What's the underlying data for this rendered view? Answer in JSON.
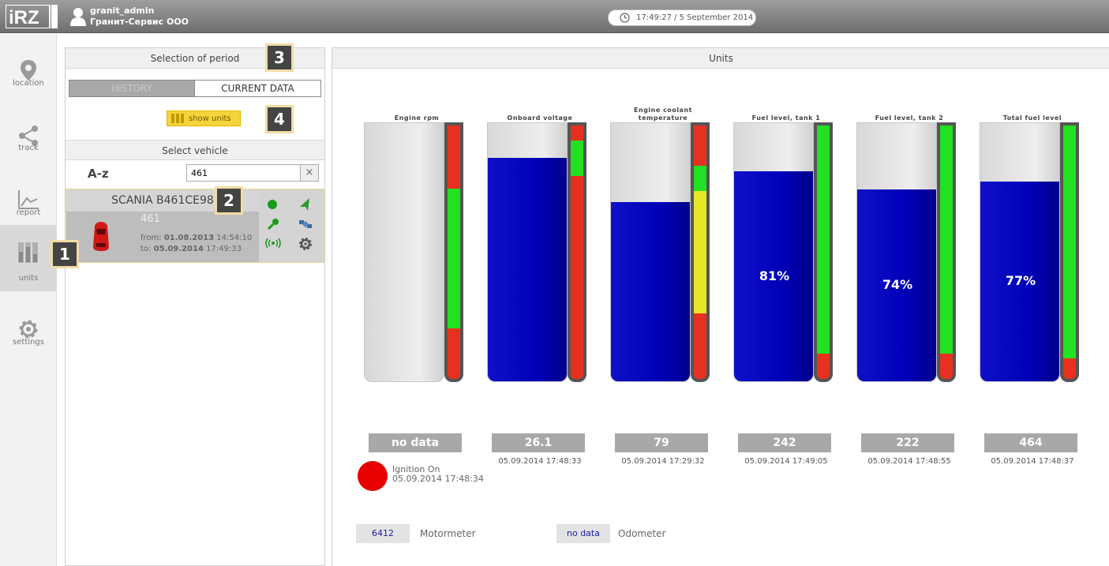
{
  "header": {
    "logo_text": "iRZ online",
    "user_name": "granit_admin",
    "user_org": "Гранит-Сервис ООО",
    "clock": "17:49:27 / 5 September 2014"
  },
  "nav": [
    {
      "label": "location",
      "icon": "location-pin-icon"
    },
    {
      "label": "track",
      "icon": "share-icon"
    },
    {
      "label": "report",
      "icon": "line-chart-icon"
    },
    {
      "label": "units",
      "icon": "units-bars-icon"
    },
    {
      "label": "settings",
      "icon": "gear-icon"
    }
  ],
  "badges": [
    "1",
    "2",
    "3",
    "4"
  ],
  "period": {
    "title": "Selection of period",
    "tab_history": "HISTORY",
    "tab_current": "CURRENT DATA",
    "show_units": "show units"
  },
  "vehicle_select": {
    "title": "Select vehicle",
    "sort_label": "A-z",
    "search_value": "461",
    "clear": "×"
  },
  "vehicle": {
    "name": "SCANIA B461CE98",
    "number": "461",
    "from_label": "from:",
    "from_date": "01.08.2013",
    "from_time": "14:54:10",
    "to_label": "to:",
    "to_date": "05.09.2014",
    "to_time": "17:49:33"
  },
  "units": {
    "title": "Units",
    "gauges": [
      {
        "name": "Engine rpm",
        "value": "no data",
        "time": "",
        "level": 0,
        "pct": ""
      },
      {
        "name": "Onboard voltage",
        "value": "26.1",
        "time": "05.09.2014 17:48:33",
        "level": 0.86,
        "pct": ""
      },
      {
        "name": "Engine coolant temperature",
        "value": "79",
        "time": "05.09.2014 17:29:32",
        "level": 0.69,
        "pct": ""
      },
      {
        "name": "Fuel level, tank 1",
        "value": "242",
        "time": "05.09.2014 17:49:05",
        "level": 0.81,
        "pct": "81%"
      },
      {
        "name": "Fuel level, tank 2",
        "value": "222",
        "time": "05.09.2014 17:48:55",
        "level": 0.74,
        "pct": "74%"
      },
      {
        "name": "Total fuel level",
        "value": "464",
        "time": "05.09.2014 17:48:37",
        "level": 0.77,
        "pct": "77%"
      }
    ],
    "ignition": {
      "label": "Ignition On",
      "time": "05.09.2014 17:48:34",
      "color": "#e80000"
    },
    "motormeter": {
      "value": "6412",
      "label": "Motormeter"
    },
    "odometer": {
      "value": "no data",
      "label": "Odometer"
    }
  },
  "colors": {
    "accent_yellow": "#f5d33a",
    "tank_blue": "#0000b8",
    "scale_green": "#22e022",
    "scale_red": "#e83020",
    "scale_yellow": "#e6e628"
  }
}
